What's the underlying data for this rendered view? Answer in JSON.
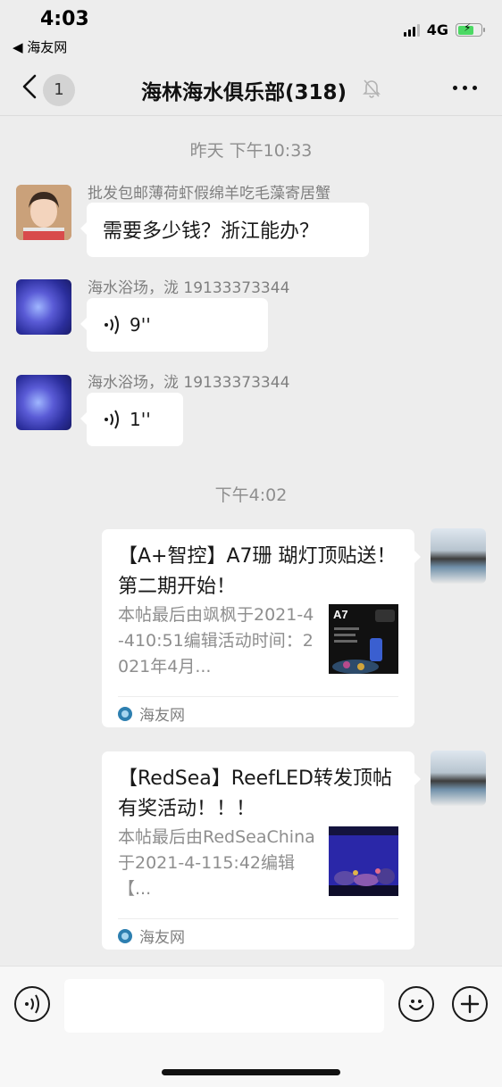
{
  "status_bar": {
    "time": "4:03",
    "back_app": "◀ 海友网",
    "network": "4G"
  },
  "nav": {
    "back_count": "1",
    "title": "海林海水俱乐部(318)"
  },
  "messages": {
    "ts1": "昨天 下午10:33",
    "m1": {
      "sender": "批发包邮薄荷虾假绵羊吃毛藻寄居蟹",
      "text": "需要多少钱？浙江能办？"
    },
    "m2": {
      "sender": "海水浴场，泷 19133373344",
      "duration": "9''"
    },
    "m3": {
      "sender": "海水浴场，泷 19133373344",
      "duration": "1''"
    },
    "ts2": "下午4:02",
    "card1": {
      "title": "【A+智控】A7珊 瑚灯顶贴送！第二期开始！",
      "desc": "本帖最后由飒枫于2021-4-410:51编辑活动时间：2021年4月...",
      "thumb_label": "A7",
      "source": "海友网"
    },
    "card2": {
      "title": "【RedSea】ReefLED转发顶帖有奖活动！！！",
      "desc": "本帖最后由RedSeaChina于2021-4-115:42编辑【...",
      "source": "海友网"
    }
  },
  "icons": {
    "voice": "voice-icon",
    "emoji": "emoji-icon",
    "plus": "plus-icon",
    "mute": "mute-icon",
    "more": "more-icon"
  }
}
